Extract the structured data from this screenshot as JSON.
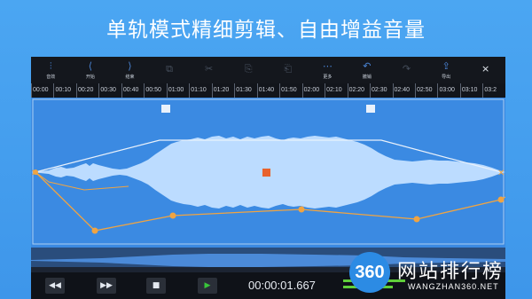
{
  "headline": "单轨模式精细剪辑、自由增益音量",
  "toolbar": {
    "items": [
      {
        "icon": "sliders-icon",
        "glyph": "⫶",
        "label": "音效",
        "enabled": true
      },
      {
        "icon": "start-marker-icon",
        "glyph": "⟨",
        "label": "开始",
        "enabled": true
      },
      {
        "icon": "end-marker-icon",
        "glyph": "⟩",
        "label": "结束",
        "enabled": true
      },
      {
        "icon": "crop-icon",
        "glyph": "⧉",
        "label": "",
        "enabled": false
      },
      {
        "icon": "cut-icon",
        "glyph": "✂",
        "label": "",
        "enabled": true
      },
      {
        "icon": "copy-icon",
        "glyph": "⎘",
        "label": "",
        "enabled": false
      },
      {
        "icon": "paste-icon",
        "glyph": "⎗",
        "label": "",
        "enabled": false
      },
      {
        "icon": "more-icon",
        "glyph": "⋯",
        "label": "更多",
        "enabled": true
      },
      {
        "icon": "undo-icon",
        "glyph": "↶",
        "label": "撤销",
        "enabled": true
      },
      {
        "icon": "redo-icon",
        "glyph": "↷",
        "label": "",
        "enabled": false
      },
      {
        "icon": "export-icon",
        "glyph": "⇪",
        "label": "导出",
        "enabled": true
      },
      {
        "icon": "close-icon",
        "glyph": "×",
        "label": "",
        "enabled": true
      }
    ]
  },
  "ruler": {
    "labels": [
      "00:00",
      "00:10",
      "00:20",
      "00:30",
      "00:40",
      "00:50",
      "01:00",
      "01:10",
      "01:20",
      "01:30",
      "01:40",
      "01:50",
      "02:00",
      "02:10",
      "02:20",
      "02:30",
      "02:40",
      "02:50",
      "03:00",
      "03:10",
      "03:2"
    ]
  },
  "transport": {
    "rewind_glyph": "◀◀",
    "forward_glyph": "▶▶",
    "stop_glyph": "■",
    "play_glyph": "▶",
    "time": "00:00:01.667"
  },
  "watermark": {
    "badge": "360",
    "text": "网站排行榜",
    "sub": "WANGZHAN360.NET"
  },
  "colors": {
    "background": "#3e96ea",
    "waveform": "#bcdcff",
    "envelope": "#f0a442",
    "play_button": "#39c53a",
    "marker": "#e8622c"
  }
}
